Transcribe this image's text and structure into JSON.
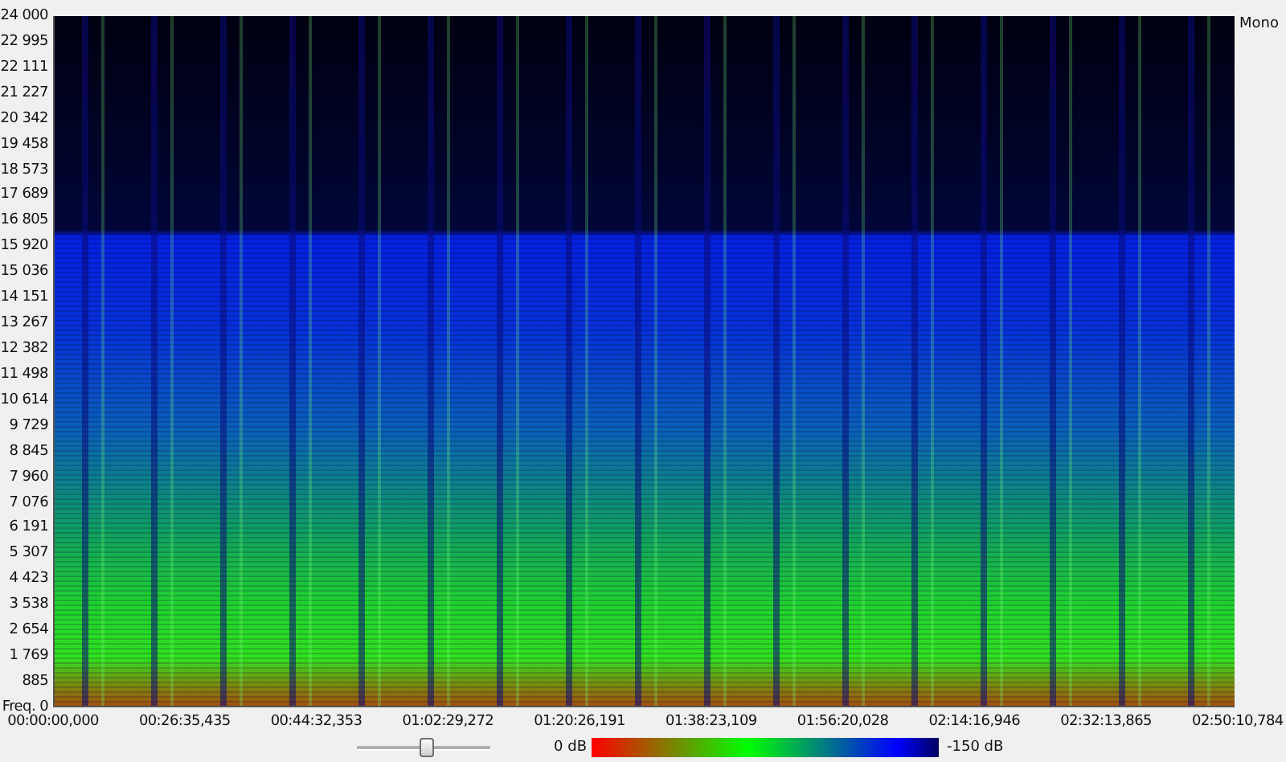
{
  "y_axis": {
    "labels": [
      "24 000",
      "22 995",
      "22 111",
      "21 227",
      "20 342",
      "19 458",
      "18 573",
      "17 689",
      "16 805",
      "15 920",
      "15 036",
      "14 151",
      "13 267",
      "12 382",
      "11 498",
      "10 614",
      "9 729",
      "8 845",
      "7 960",
      "7 076",
      "6 191",
      "5 307",
      "4 423",
      "3 538",
      "2 654",
      "1 769",
      "885",
      "Freq. 0"
    ]
  },
  "channel_label": "Mono",
  "x_axis": {
    "labels": [
      "00:00:00,000",
      "00:26:35,435",
      "00:44:32,353",
      "01:02:29,272",
      "01:20:26,191",
      "01:38:23,109",
      "01:56:20,028",
      "02:14:16,946",
      "02:32:13,865",
      "02:50:10,784"
    ]
  },
  "zoom_slider": {
    "level": 0.52
  },
  "color_scale": {
    "max_label": "0 dB",
    "min_label": "-150 dB"
  }
}
